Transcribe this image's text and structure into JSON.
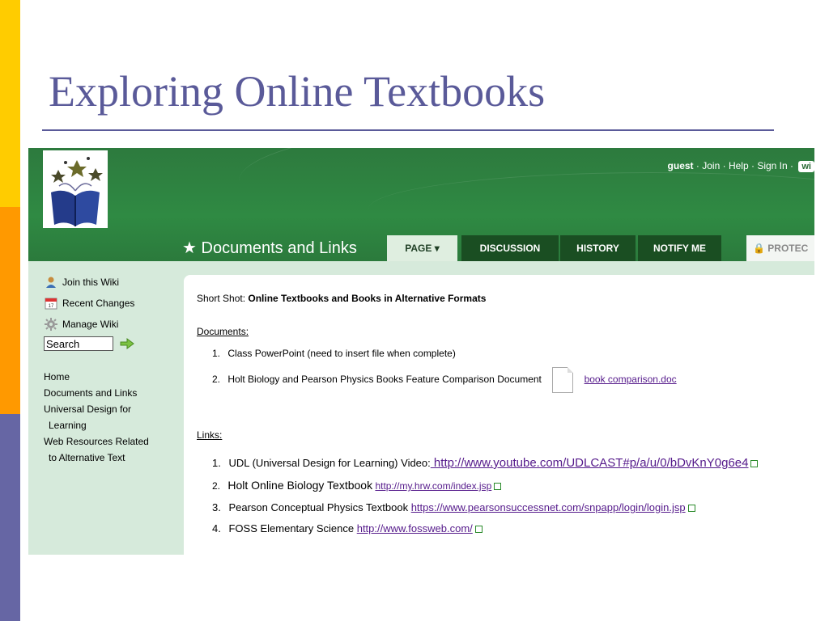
{
  "slide": {
    "title": "Exploring Online Textbooks"
  },
  "header": {
    "user": "guest",
    "links": [
      "Join",
      "Help",
      "Sign In"
    ],
    "wiki_badge": "wi",
    "page_heading": "Documents and Links",
    "star": "★"
  },
  "tabs": [
    {
      "label": "PAGE ▾",
      "active": true
    },
    {
      "label": "DISCUSSION",
      "active": false
    },
    {
      "label": "HISTORY",
      "active": false
    },
    {
      "label": "NOTIFY ME",
      "active": false
    }
  ],
  "protect_label": "PROTEC",
  "sidebar": {
    "tools": [
      {
        "label": "Join this Wiki",
        "icon": "user-icon"
      },
      {
        "label": "Recent Changes",
        "icon": "calendar-icon"
      },
      {
        "label": "Manage Wiki",
        "icon": "gear-icon"
      }
    ],
    "search_value": "Search",
    "nav": [
      "Home",
      "Documents and Links",
      "Universal Design for",
      "Learning",
      "Web Resources Related",
      "to Alternative Text"
    ]
  },
  "content": {
    "short_shot_prefix": "Short Shot:",
    "short_shot_title": "Online Textbooks and Books in Alternative Formats",
    "documents_heading": "Documents:",
    "documents": [
      {
        "num": "1.",
        "text": "Class PowerPoint (need to insert file when complete)"
      },
      {
        "num": "2.",
        "text": "Holt Biology and Pearson Physics Books Feature Comparison Document",
        "file": "book comparison.doc"
      }
    ],
    "links_heading": "Links:",
    "links": [
      {
        "num": "1.",
        "text": "UDL (Universal Design for Learning) Video:",
        "url": " http://www.youtube.com/UDLCAST#p/a/u/0/bDvKnY0g6e4"
      },
      {
        "num": "2.",
        "text": "Holt Online Biology Textbook",
        "url": "http://my.hrw.com/index.jsp"
      },
      {
        "num": "3.",
        "text": "Pearson Conceptual Physics Textbook",
        "url": "https://www.pearsonsuccessnet.com/snpapp/login/login.jsp"
      },
      {
        "num": "4.",
        "text": "FOSS Elementary Science",
        "url": "http://www.fossweb.com/"
      }
    ]
  }
}
